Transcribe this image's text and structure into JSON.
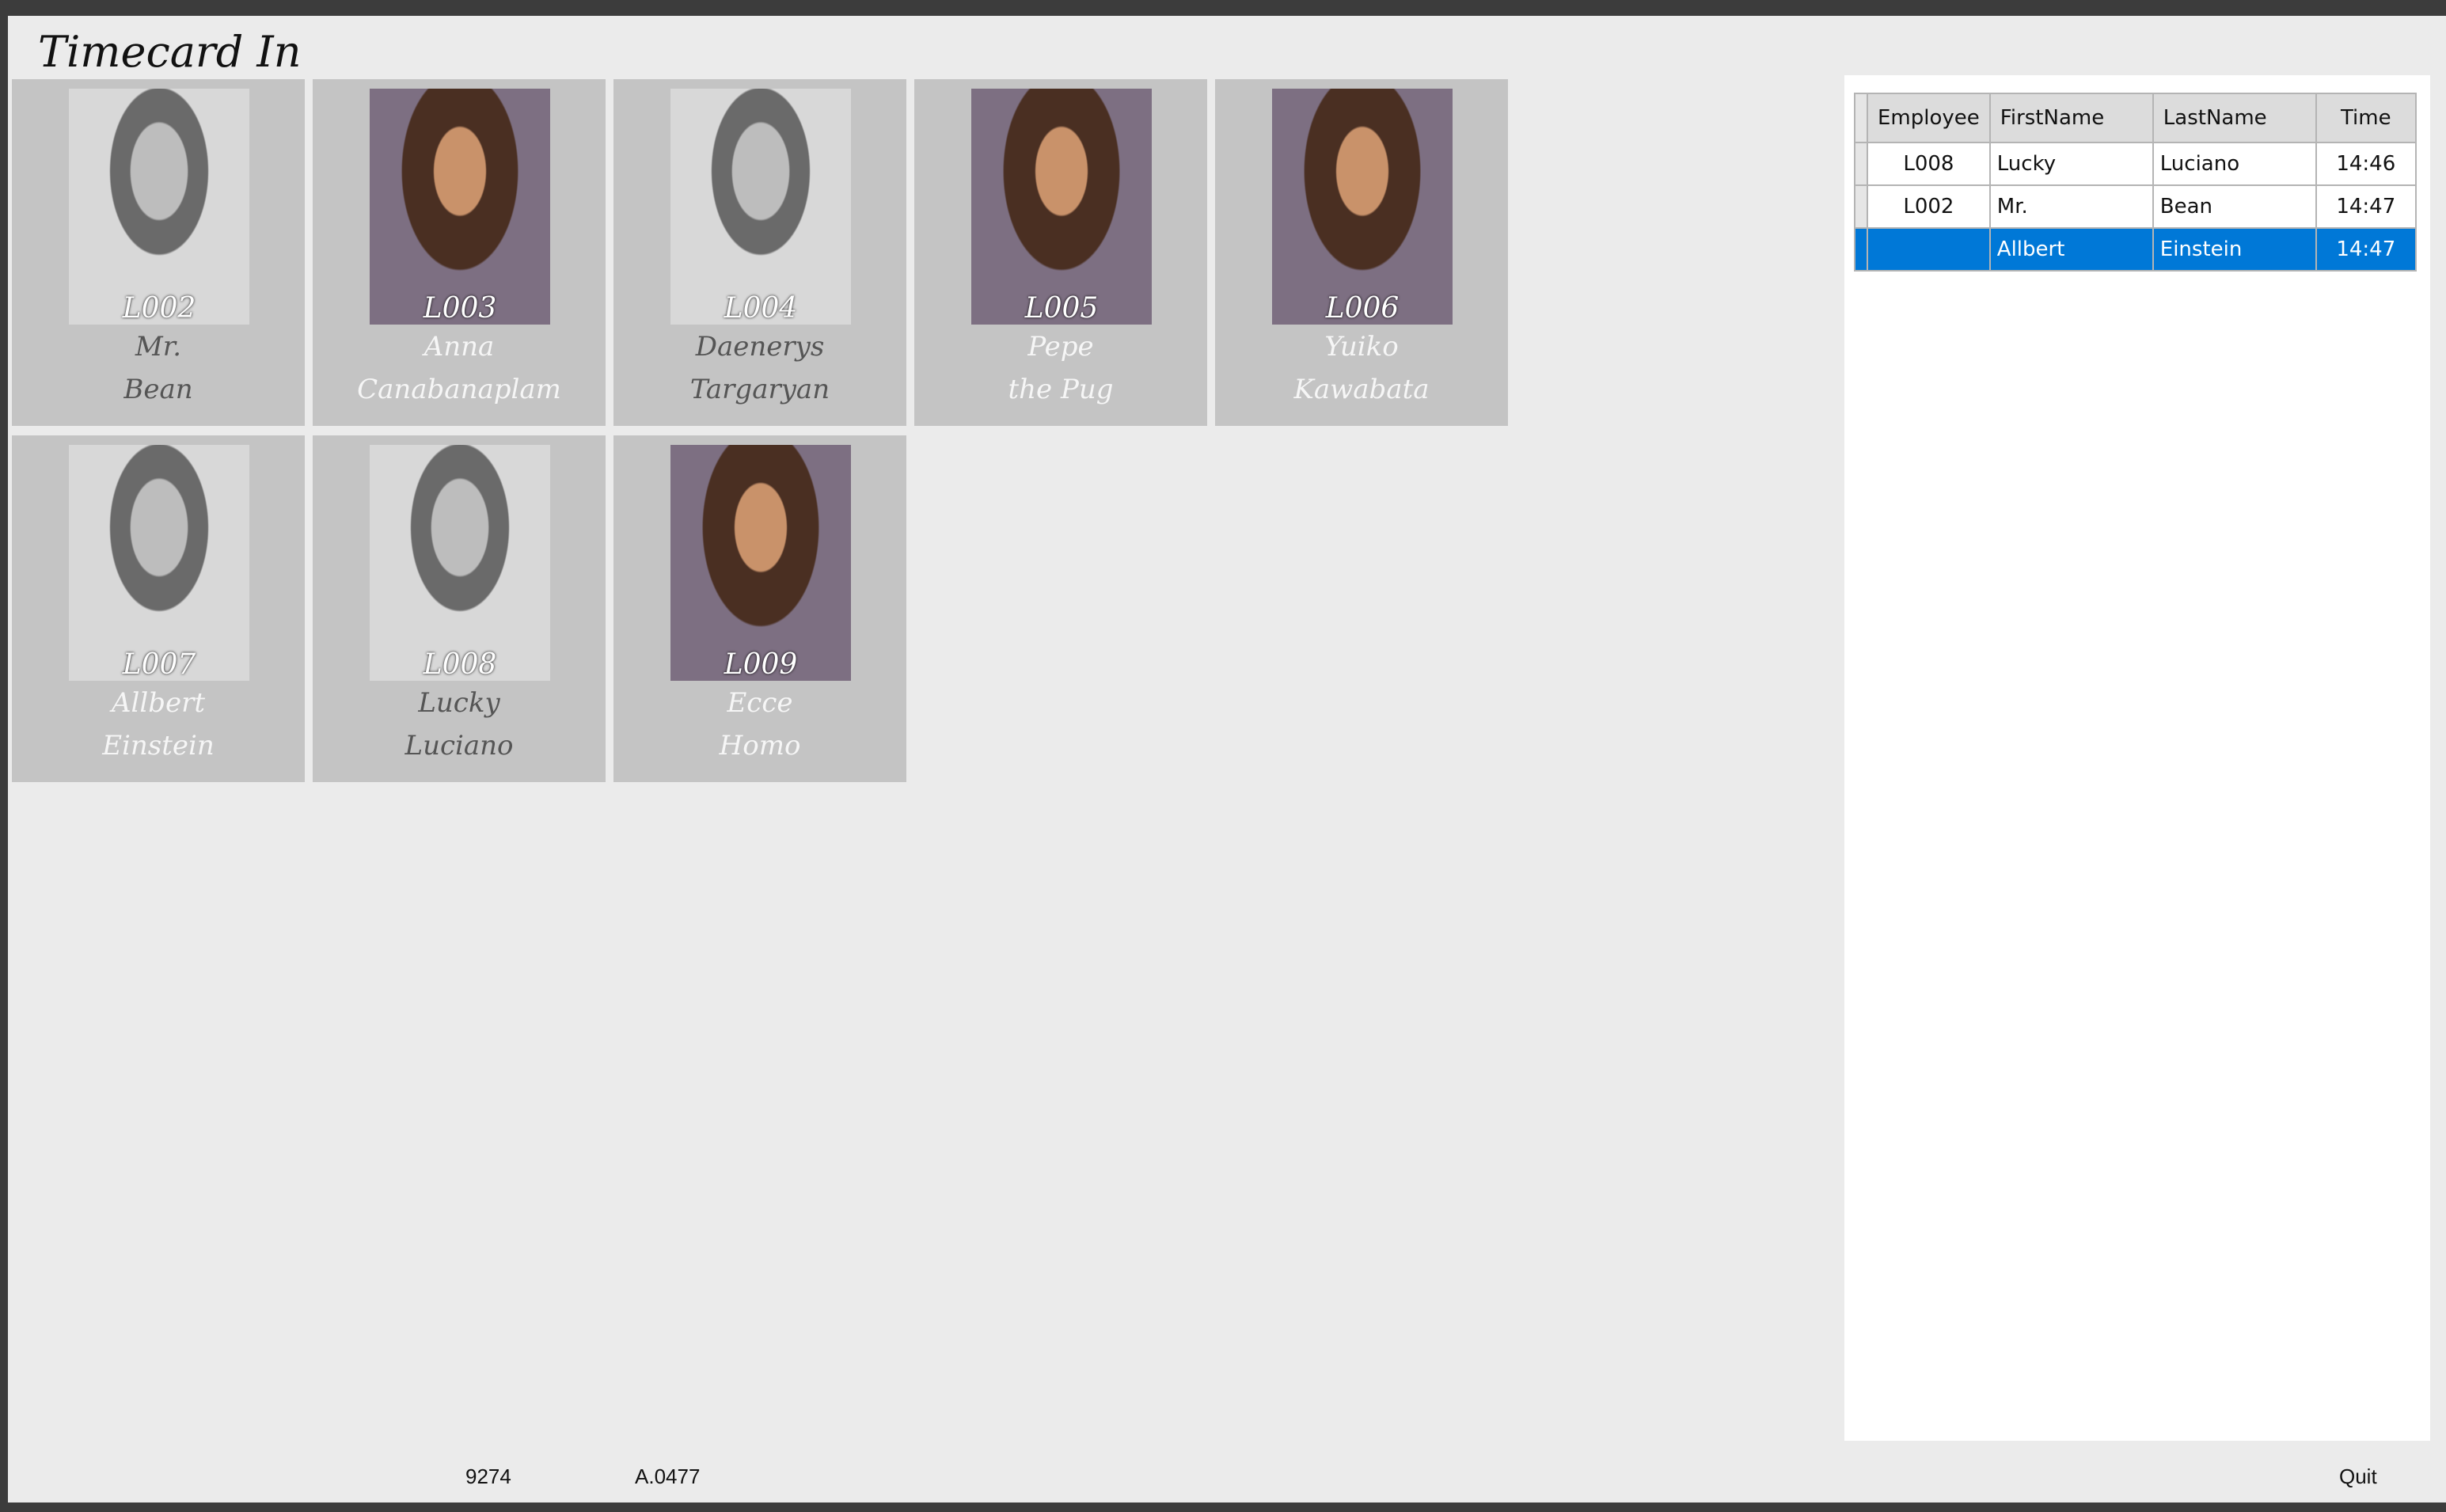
{
  "title": "Timecard In",
  "employees": [
    {
      "id": "L002",
      "first": "Mr.",
      "last": "Bean",
      "photo": "grayscale",
      "name_color": "#555555"
    },
    {
      "id": "L003",
      "first": "Anna",
      "last": "Canabanaplam",
      "photo": "color",
      "name_color": "#f6f6f6"
    },
    {
      "id": "L004",
      "first": "Daenerys",
      "last": "Targaryan",
      "photo": "grayscale",
      "name_color": "#555555"
    },
    {
      "id": "L005",
      "first": "Pepe",
      "last": "the Pug",
      "photo": "color",
      "name_color": "#f6f6f6"
    },
    {
      "id": "L006",
      "first": "Yuiko",
      "last": "Kawabata",
      "photo": "color",
      "name_color": "#f6f6f6"
    },
    {
      "id": "L007",
      "first": "Allbert",
      "last": "Einstein",
      "photo": "grayscale",
      "name_color": "#f6f6f6"
    },
    {
      "id": "L008",
      "first": "Lucky",
      "last": "Luciano",
      "photo": "grayscale",
      "name_color": "#555555"
    },
    {
      "id": "L009",
      "first": "Ecce",
      "last": "Homo",
      "photo": "color",
      "name_color": "#f6f6f6"
    }
  ],
  "grid": {
    "headers": [
      "Employee",
      "FirstName",
      "LastName",
      "Time"
    ],
    "rows": [
      [
        "L008",
        "Lucky",
        "Luciano",
        "14:46"
      ],
      [
        "L002",
        "Mr.",
        "Bean",
        "14:47"
      ],
      [
        "",
        "Allbert",
        "Einstein",
        "14:47"
      ]
    ],
    "selected_row": 2,
    "selection_color": "#0078d7"
  },
  "footer": {
    "code1": "9274",
    "code2": "A.0477",
    "quit": "Quit"
  }
}
